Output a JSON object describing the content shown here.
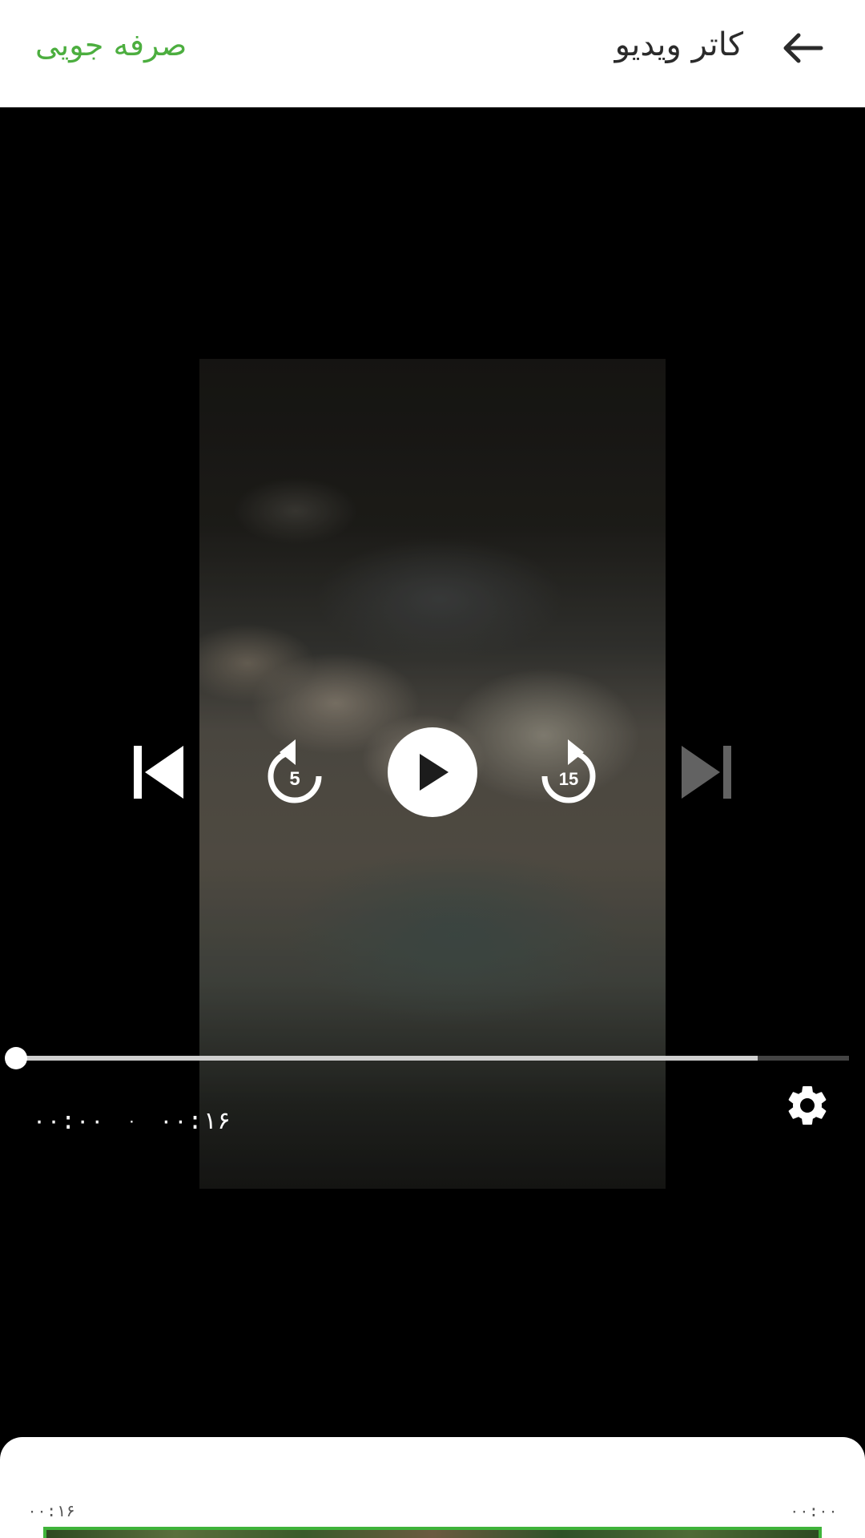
{
  "header": {
    "title": "کاتر ویدیو",
    "save_label": "صرفه جویی",
    "back_icon": "arrow-left-icon"
  },
  "player": {
    "rewind_seconds": "5",
    "forward_seconds": "15",
    "progress": 0,
    "buffered": 0.89,
    "current_time": "۰۰:۰۰",
    "separator": "۰",
    "duration": "۰۰:۱۶",
    "icons": [
      "skip-previous-icon",
      "replay-5-icon",
      "play-icon",
      "forward-15-icon",
      "skip-next-icon",
      "settings-gear-icon"
    ]
  },
  "trimmer": {
    "start_time": "۰۰:۱۶",
    "end_time": "۰۰:۰۰"
  },
  "colors": {
    "accent": "#4cae3f",
    "frame_border": "#3fb33a"
  }
}
